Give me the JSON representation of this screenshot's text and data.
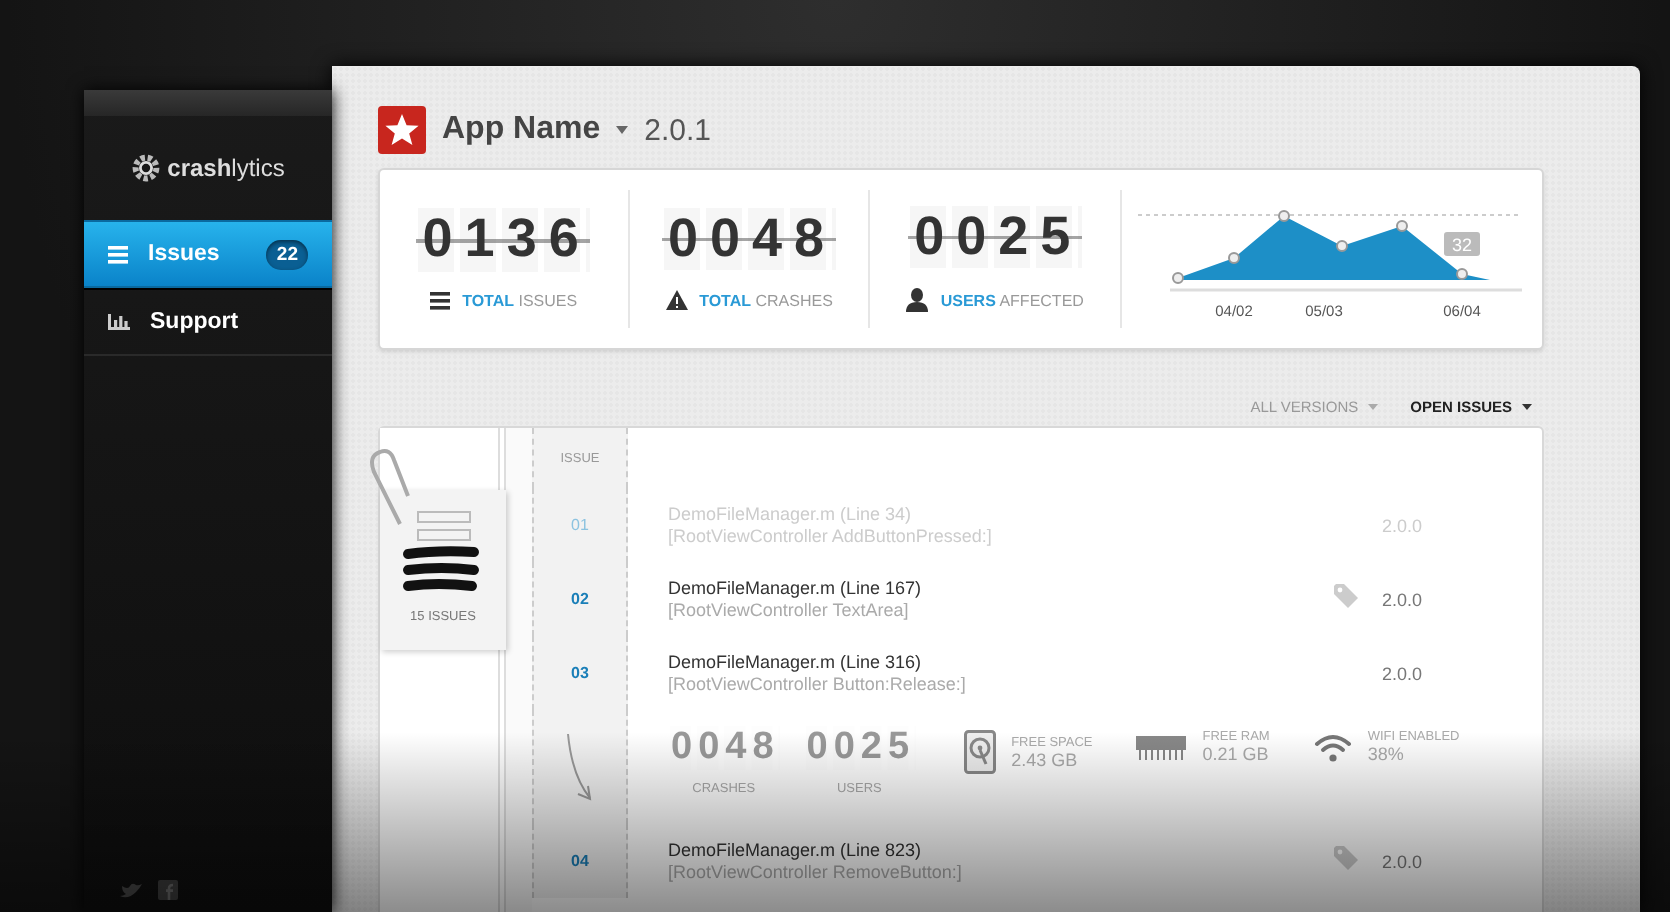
{
  "sidebar": {
    "logo": "**crash**lytics",
    "items": [
      {
        "kind": "issues",
        "label": "Issues",
        "badge": "22",
        "selected": true
      },
      {
        "kind": "support",
        "label": "Support",
        "selected": false
      }
    ]
  },
  "app": {
    "name": "App Name",
    "version": "2.0.1"
  },
  "stats": [
    {
      "kind": "issues",
      "value": "0136",
      "label": "**TOTAL** ISSUES"
    },
    {
      "kind": "crashes",
      "value": "0048",
      "label": "**TOTAL** CRASHES"
    },
    {
      "kind": "users",
      "value": "0025",
      "label": "**USERS** AFFECTED"
    }
  ],
  "chart": {
    "x_labels": [
      "04/02",
      "05/03",
      "06/04"
    ],
    "callout": "32"
  },
  "filters": [
    {
      "label": "ALL VERSIONS",
      "selected": false
    },
    {
      "label": "OPEN ISSUES",
      "selected": true
    }
  ],
  "issues": {
    "folder_label": "15 ISSUES",
    "column_header": "ISSUE",
    "rows": [
      {
        "number": "01",
        "file": "DemoFileManager.m (Line 34)",
        "method": "[RootViewController AddButtonPressed:]",
        "version": "2.0.0",
        "tagged": false,
        "muted": true
      },
      {
        "number": "02",
        "file": "DemoFileManager.m (Line 167)",
        "method": "[RootViewController TextArea]",
        "version": "2.0.0",
        "tagged": true,
        "muted": false
      },
      {
        "number": "03",
        "file": "DemoFileManager.m (Line 316)",
        "method": "[RootViewController Button:Release:]",
        "version": "2.0.0",
        "tagged": false,
        "muted": false,
        "details": {
          "counters": [
            {
              "value": "0048",
              "label": "CRASHES"
            },
            {
              "value": "0025",
              "label": "USERS"
            }
          ],
          "device": [
            {
              "kind": "disk",
              "label": "FREE SPACE",
              "value": "2.43 GB"
            },
            {
              "kind": "ram",
              "label": "FREE RAM",
              "value": "0.21 GB"
            },
            {
              "kind": "wifi",
              "label": "WIFI ENABLED",
              "value": "38%"
            }
          ]
        }
      },
      {
        "number": "04",
        "file": "DemoFileManager.m (Line 823)",
        "method": "[RootViewController RemoveButton:]",
        "version": "2.0.0",
        "tagged": true,
        "muted": false
      }
    ]
  }
}
